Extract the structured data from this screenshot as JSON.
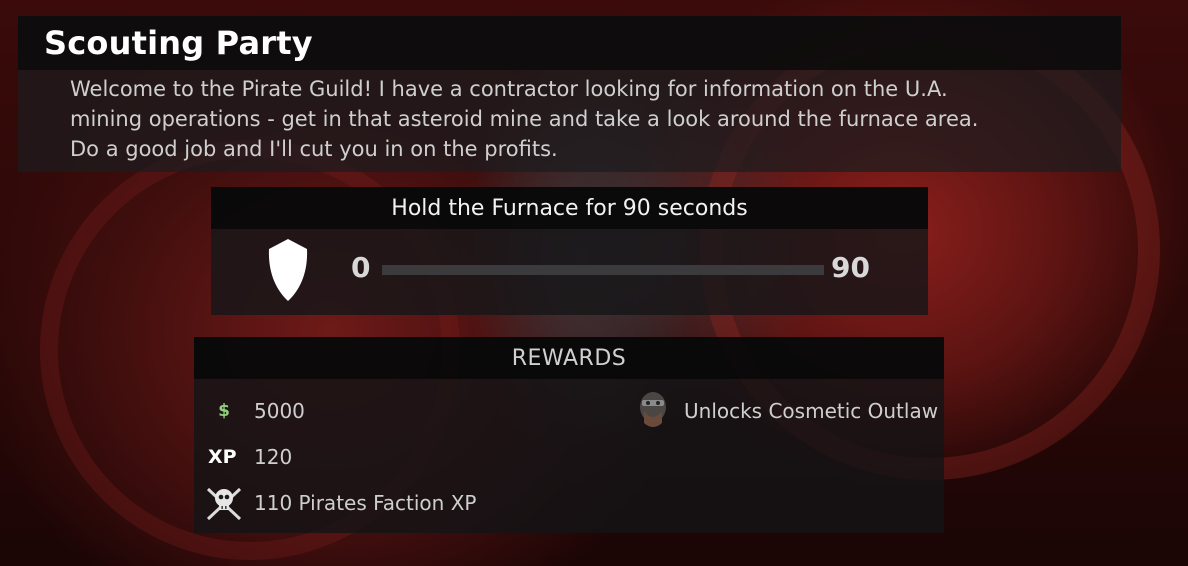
{
  "mission": {
    "title": "Scouting Party",
    "description_lines": [
      "Welcome to the Pirate Guild! I have a contractor looking for information on the U.A.",
      "mining operations - get in that asteroid mine and take a look around the furnace area.",
      "Do a good job and I'll cut you in on the profits."
    ]
  },
  "objective": {
    "title": "Hold the Furnace for 90 seconds",
    "icon": "shield-icon",
    "progress_min": "0",
    "progress_max": "90",
    "progress_fraction": 0
  },
  "rewards": {
    "title": "REWARDS",
    "money": {
      "icon": "dollar-icon",
      "symbol": "$",
      "value": "5000"
    },
    "xp": {
      "icon": "xp-icon",
      "label": "XP",
      "value": "120"
    },
    "faction": {
      "icon": "pirate-skull-icon",
      "text": "110 Pirates Faction XP"
    },
    "cosmetic": {
      "icon": "outlaw-mask-icon",
      "text": "Unlocks Cosmetic Outlaw"
    }
  },
  "colors": {
    "money_green": "#8fcf7d",
    "panel_dark": "#0a0a0a",
    "background_red": "#5d1412"
  }
}
